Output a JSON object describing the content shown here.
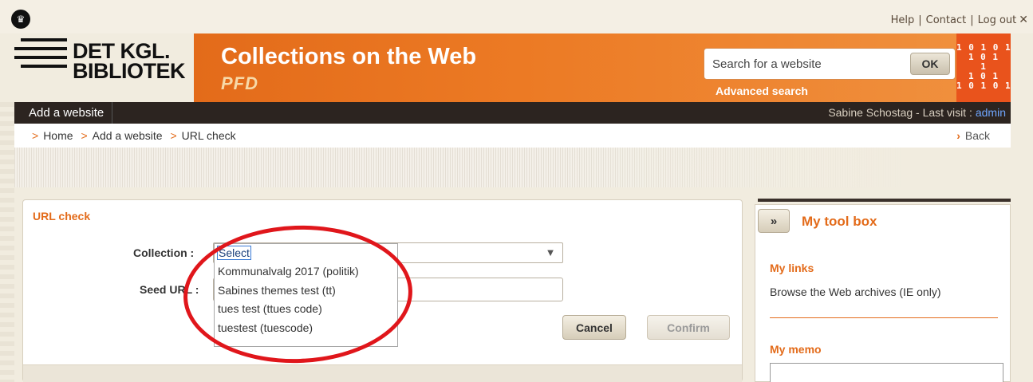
{
  "top_links": {
    "help": "Help",
    "contact": "Contact",
    "logout": "Log out",
    "close_glyph": "✕",
    "sep": "|"
  },
  "logo": {
    "line1": "DET KGL.",
    "line2": "BIBLIOTEK",
    "crown_glyph": "♛"
  },
  "header": {
    "title": "Collections on the Web",
    "subtitle": "PFD"
  },
  "search": {
    "placeholder": "Search for a website",
    "ok_label": "OK",
    "advanced_label": "Advanced search"
  },
  "binary_logo": [
    "1 0 1 0 1",
    "1 0 1",
    "1",
    "1 0 1",
    "1 0 1 0 1"
  ],
  "nav": {
    "tab_label": "Add a website",
    "user_text": "Sabine Schostag - Last visit :",
    "user_role": "admin"
  },
  "breadcrumb": {
    "items": [
      "Home",
      "Add a website",
      "URL check"
    ],
    "arrow": ">",
    "back_label": "Back",
    "back_arrow": "›"
  },
  "form": {
    "section_title": "URL check",
    "collection_label": "Collection :",
    "seed_url_label": "Seed URL :",
    "collection_selected": "Select",
    "dropdown_arrow": "▼",
    "dropdown_options": [
      "Select",
      "Kommunalvalg 2017 (politik)",
      "Sabines themes test (tt)",
      "tues test (ttues code)",
      "tuestest (tuescode)"
    ],
    "cancel_label": "Cancel",
    "confirm_label": "Confirm"
  },
  "toolbox": {
    "toggle_label": "»",
    "title": "My tool box",
    "links_heading": "My links",
    "link_browse": "Browse the Web archives (IE only)",
    "memo_heading": "My memo"
  },
  "colors": {
    "accent": "#e36b1a",
    "nav_bg": "#2c2420",
    "highlight_ring": "#e0161b",
    "admin_link": "#6fa6ff"
  }
}
